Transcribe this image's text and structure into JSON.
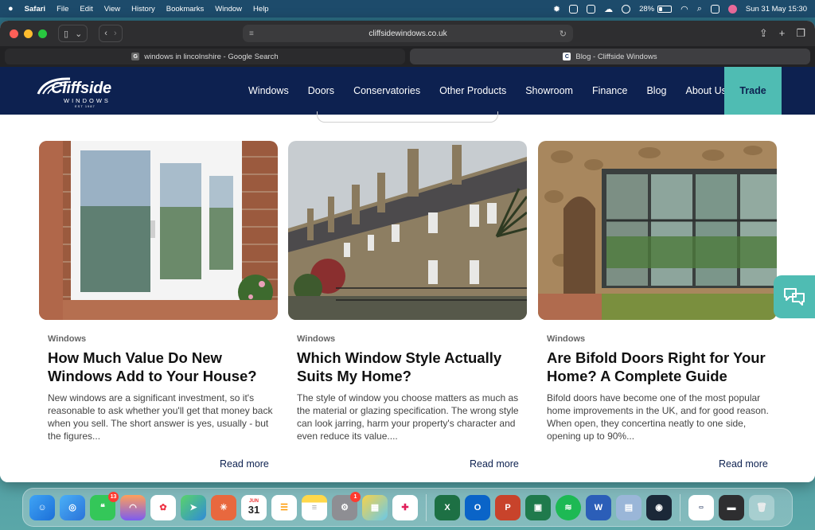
{
  "menubar": {
    "apple": "",
    "app": "Safari",
    "items": [
      "File",
      "Edit",
      "View",
      "History",
      "Bookmarks",
      "Window",
      "Help"
    ],
    "battery_percent": "28%",
    "battery_level": 0.28,
    "clock": "Sun 31 May  15:30"
  },
  "browser": {
    "address": "cliffsidewindows.co.uk",
    "tabs": [
      {
        "favicon": "G",
        "label": "windows in lincolnshire - Google Search"
      },
      {
        "favicon": "C",
        "label": "Blog - Cliffside Windows"
      }
    ]
  },
  "site": {
    "logo": {
      "brand": "Cliffside",
      "sub": "WINDOWS",
      "est": "EST 1987"
    },
    "nav": [
      "Windows",
      "Doors",
      "Conservatories",
      "Other Products",
      "Showroom",
      "Finance",
      "Blog",
      "About Us"
    ],
    "trade": "Trade",
    "colors": {
      "navy": "#0d2150",
      "teal": "#4fbcb3"
    }
  },
  "cards": [
    {
      "category": "Windows",
      "title": "How Much Value Do New Windows Add to Your House?",
      "excerpt": "New windows are a significant investment, so it's reasonable to ask whether you'll get that money back when you sell. The short answer is yes, usually - but the figures...",
      "cta": "Read more"
    },
    {
      "category": "Windows",
      "title": "Which Window Style Actually Suits My Home?",
      "excerpt": "The style of window you choose matters as much as the material or glazing specification. The wrong style can look jarring, harm your property's character and even reduce its value....",
      "cta": "Read more"
    },
    {
      "category": "Windows",
      "title": "Are Bifold Doors Right for Your Home? A Complete Guide",
      "excerpt": "Bifold doors have become one of the most popular home improvements in the UK, and for good reason. When open, they concertina neatly to one side, opening up to 90%...",
      "cta": "Read more"
    }
  ],
  "dock": {
    "messages_badge": "13",
    "settings_badge": "1",
    "calendar_month": "JUN",
    "calendar_day": "31"
  }
}
